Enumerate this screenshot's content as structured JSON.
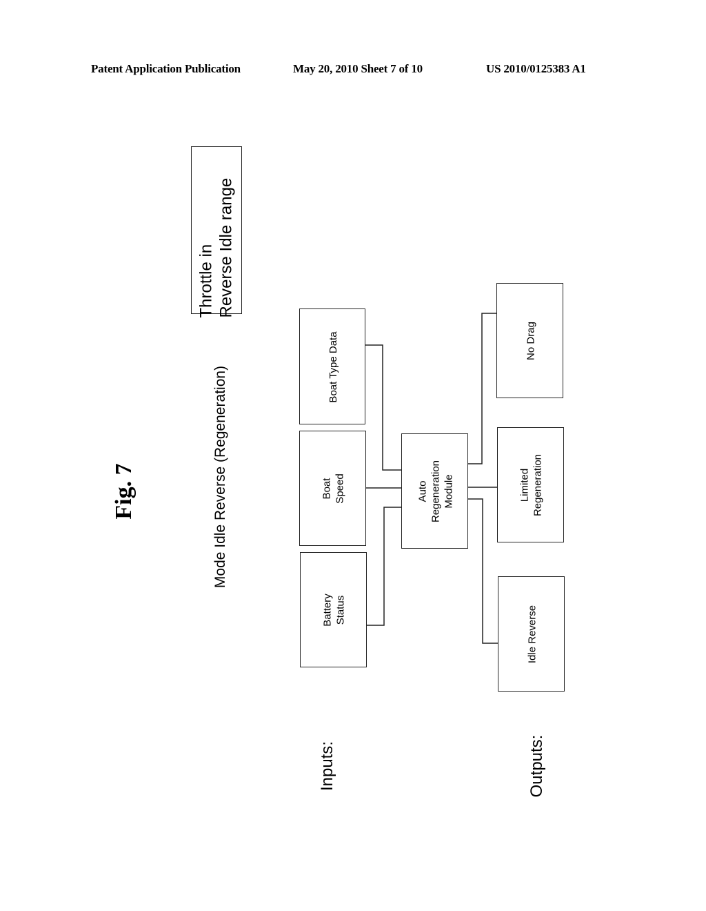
{
  "header": {
    "publication": "Patent Application Publication",
    "date_sheet": "May 20, 2010  Sheet 7 of 10",
    "number": "US 2010/0125383 A1"
  },
  "figure": {
    "label": "Fig. 7",
    "title": "Mode Idle Reverse (Regeneration)",
    "condition": {
      "line1": "Throttle in",
      "line2": "Reverse Idle range"
    }
  },
  "sections": {
    "inputs": "Inputs:",
    "outputs": "Outputs:"
  },
  "inputs": [
    {
      "line1": "Boat Type Data",
      "line2": ""
    },
    {
      "line1": "Boat",
      "line2": "Speed"
    },
    {
      "line1": "Battery",
      "line2": "Status"
    }
  ],
  "module": {
    "line1": "Auto",
    "line2": "Regeneration",
    "line3": "Module"
  },
  "outputs": [
    {
      "line1": "No Drag",
      "line2": ""
    },
    {
      "line1": "Limited",
      "line2": "Regeneration"
    },
    {
      "line1": "Idle Reverse",
      "line2": ""
    }
  ]
}
